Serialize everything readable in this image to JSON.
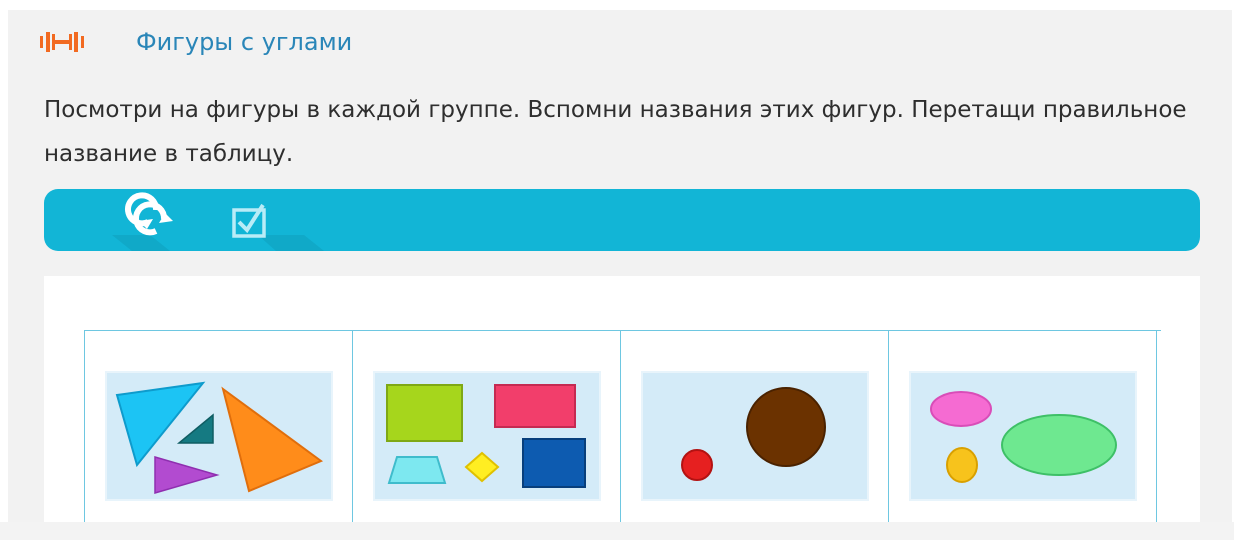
{
  "header": {
    "title": "Фигуры с углами",
    "level_icon": "difficulty-level-icon",
    "accent_color": "#f26a21"
  },
  "instruction": {
    "text": "Посмотри на фигуры в каждой группе. Вспомни названия этих фигур. Перетащи правильное название в таблицу."
  },
  "toolbar": {
    "color": "#12b5d6",
    "buttons": [
      {
        "name": "reset-button",
        "icon": "refresh-icon"
      },
      {
        "name": "check-button",
        "icon": "checkbox-icon"
      }
    ]
  },
  "table": {
    "groups": [
      {
        "shapes": "triangles",
        "colors": [
          "#1cc4f4",
          "#157a82",
          "#ff8c1a",
          "#b24bd0"
        ]
      },
      {
        "shapes": "quadrilaterals",
        "colors": [
          "#a6d61c",
          "#f23e6b",
          "#7de8f0",
          "#ffee22",
          "#0d5bb0"
        ]
      },
      {
        "shapes": "circles",
        "colors": [
          "#e62020",
          "#6b3200"
        ]
      },
      {
        "shapes": "ovals",
        "colors": [
          "#f56bd2",
          "#f7c31c",
          "#6ee890"
        ]
      }
    ]
  }
}
